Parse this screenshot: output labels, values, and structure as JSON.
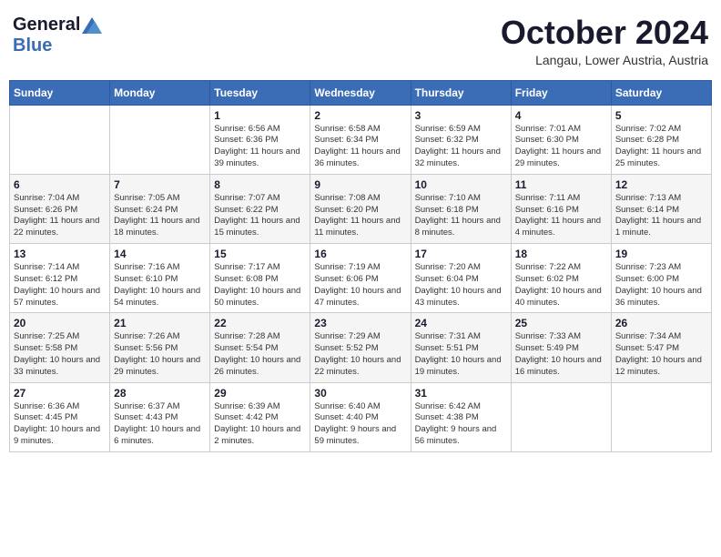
{
  "header": {
    "logo_general": "General",
    "logo_blue": "Blue",
    "title": "October 2024",
    "location": "Langau, Lower Austria, Austria"
  },
  "calendar": {
    "days_of_week": [
      "Sunday",
      "Monday",
      "Tuesday",
      "Wednesday",
      "Thursday",
      "Friday",
      "Saturday"
    ],
    "weeks": [
      [
        {
          "day": "",
          "info": ""
        },
        {
          "day": "",
          "info": ""
        },
        {
          "day": "1",
          "info": "Sunrise: 6:56 AM\nSunset: 6:36 PM\nDaylight: 11 hours and 39 minutes."
        },
        {
          "day": "2",
          "info": "Sunrise: 6:58 AM\nSunset: 6:34 PM\nDaylight: 11 hours and 36 minutes."
        },
        {
          "day": "3",
          "info": "Sunrise: 6:59 AM\nSunset: 6:32 PM\nDaylight: 11 hours and 32 minutes."
        },
        {
          "day": "4",
          "info": "Sunrise: 7:01 AM\nSunset: 6:30 PM\nDaylight: 11 hours and 29 minutes."
        },
        {
          "day": "5",
          "info": "Sunrise: 7:02 AM\nSunset: 6:28 PM\nDaylight: 11 hours and 25 minutes."
        }
      ],
      [
        {
          "day": "6",
          "info": "Sunrise: 7:04 AM\nSunset: 6:26 PM\nDaylight: 11 hours and 22 minutes."
        },
        {
          "day": "7",
          "info": "Sunrise: 7:05 AM\nSunset: 6:24 PM\nDaylight: 11 hours and 18 minutes."
        },
        {
          "day": "8",
          "info": "Sunrise: 7:07 AM\nSunset: 6:22 PM\nDaylight: 11 hours and 15 minutes."
        },
        {
          "day": "9",
          "info": "Sunrise: 7:08 AM\nSunset: 6:20 PM\nDaylight: 11 hours and 11 minutes."
        },
        {
          "day": "10",
          "info": "Sunrise: 7:10 AM\nSunset: 6:18 PM\nDaylight: 11 hours and 8 minutes."
        },
        {
          "day": "11",
          "info": "Sunrise: 7:11 AM\nSunset: 6:16 PM\nDaylight: 11 hours and 4 minutes."
        },
        {
          "day": "12",
          "info": "Sunrise: 7:13 AM\nSunset: 6:14 PM\nDaylight: 11 hours and 1 minute."
        }
      ],
      [
        {
          "day": "13",
          "info": "Sunrise: 7:14 AM\nSunset: 6:12 PM\nDaylight: 10 hours and 57 minutes."
        },
        {
          "day": "14",
          "info": "Sunrise: 7:16 AM\nSunset: 6:10 PM\nDaylight: 10 hours and 54 minutes."
        },
        {
          "day": "15",
          "info": "Sunrise: 7:17 AM\nSunset: 6:08 PM\nDaylight: 10 hours and 50 minutes."
        },
        {
          "day": "16",
          "info": "Sunrise: 7:19 AM\nSunset: 6:06 PM\nDaylight: 10 hours and 47 minutes."
        },
        {
          "day": "17",
          "info": "Sunrise: 7:20 AM\nSunset: 6:04 PM\nDaylight: 10 hours and 43 minutes."
        },
        {
          "day": "18",
          "info": "Sunrise: 7:22 AM\nSunset: 6:02 PM\nDaylight: 10 hours and 40 minutes."
        },
        {
          "day": "19",
          "info": "Sunrise: 7:23 AM\nSunset: 6:00 PM\nDaylight: 10 hours and 36 minutes."
        }
      ],
      [
        {
          "day": "20",
          "info": "Sunrise: 7:25 AM\nSunset: 5:58 PM\nDaylight: 10 hours and 33 minutes."
        },
        {
          "day": "21",
          "info": "Sunrise: 7:26 AM\nSunset: 5:56 PM\nDaylight: 10 hours and 29 minutes."
        },
        {
          "day": "22",
          "info": "Sunrise: 7:28 AM\nSunset: 5:54 PM\nDaylight: 10 hours and 26 minutes."
        },
        {
          "day": "23",
          "info": "Sunrise: 7:29 AM\nSunset: 5:52 PM\nDaylight: 10 hours and 22 minutes."
        },
        {
          "day": "24",
          "info": "Sunrise: 7:31 AM\nSunset: 5:51 PM\nDaylight: 10 hours and 19 minutes."
        },
        {
          "day": "25",
          "info": "Sunrise: 7:33 AM\nSunset: 5:49 PM\nDaylight: 10 hours and 16 minutes."
        },
        {
          "day": "26",
          "info": "Sunrise: 7:34 AM\nSunset: 5:47 PM\nDaylight: 10 hours and 12 minutes."
        }
      ],
      [
        {
          "day": "27",
          "info": "Sunrise: 6:36 AM\nSunset: 4:45 PM\nDaylight: 10 hours and 9 minutes."
        },
        {
          "day": "28",
          "info": "Sunrise: 6:37 AM\nSunset: 4:43 PM\nDaylight: 10 hours and 6 minutes."
        },
        {
          "day": "29",
          "info": "Sunrise: 6:39 AM\nSunset: 4:42 PM\nDaylight: 10 hours and 2 minutes."
        },
        {
          "day": "30",
          "info": "Sunrise: 6:40 AM\nSunset: 4:40 PM\nDaylight: 9 hours and 59 minutes."
        },
        {
          "day": "31",
          "info": "Sunrise: 6:42 AM\nSunset: 4:38 PM\nDaylight: 9 hours and 56 minutes."
        },
        {
          "day": "",
          "info": ""
        },
        {
          "day": "",
          "info": ""
        }
      ]
    ]
  }
}
